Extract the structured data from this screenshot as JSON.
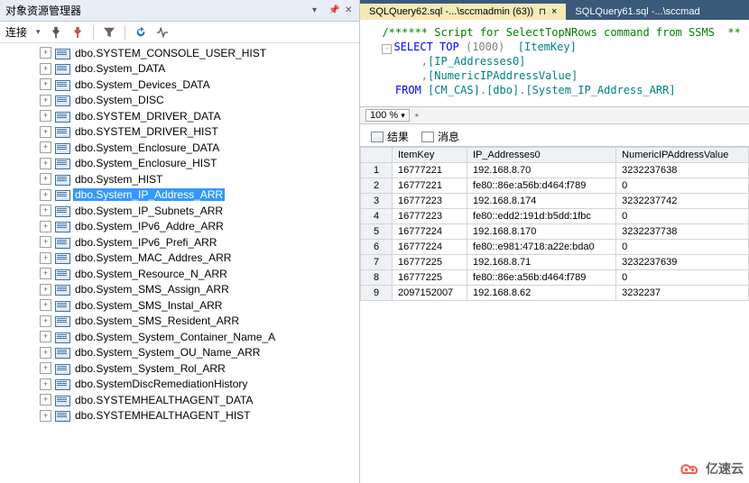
{
  "panel": {
    "title": "对象资源管理器"
  },
  "toolbar": {
    "connect_label": "连接"
  },
  "tree": {
    "items": [
      "dbo.SYSTEM_CONSOLE_USER_HIST",
      "dbo.System_DATA",
      "dbo.System_Devices_DATA",
      "dbo.System_DISC",
      "dbo.SYSTEM_DRIVER_DATA",
      "dbo.SYSTEM_DRIVER_HIST",
      "dbo.System_Enclosure_DATA",
      "dbo.System_Enclosure_HIST",
      "dbo.System_HIST",
      "dbo.System_IP_Address_ARR",
      "dbo.System_IP_Subnets_ARR",
      "dbo.System_IPv6_Addre_ARR",
      "dbo.System_IPv6_Prefi_ARR",
      "dbo.System_MAC_Addres_ARR",
      "dbo.System_Resource_N_ARR",
      "dbo.System_SMS_Assign_ARR",
      "dbo.System_SMS_Instal_ARR",
      "dbo.System_SMS_Resident_ARR",
      "dbo.System_System_Container_Name_A",
      "dbo.System_System_OU_Name_ARR",
      "dbo.System_System_Rol_ARR",
      "dbo.SystemDiscRemediationHistory",
      "dbo.SYSTEMHEALTHAGENT_DATA",
      "dbo.SYSTEMHEALTHAGENT_HIST"
    ],
    "selected_index": 9
  },
  "tabs": {
    "active": "SQLQuery62.sql -...\\sccmadmin (63))",
    "inactive": "SQLQuery61.sql -...\\sccmad"
  },
  "sql": {
    "comment": "/****** Script for SelectTopNRows command from SSMS  **",
    "select": "SELECT",
    "top": "TOP",
    "topn": "(1000)",
    "col1": "[ItemKey]",
    "col2": "[IP_Addresses0]",
    "col3": "[NumericIPAddressValue]",
    "from": "FROM",
    "db": "[CM_CAS]",
    "schema": "[dbo]",
    "table": "[System_IP_Address_ARR]"
  },
  "zoom": "100 %",
  "result_tabs": {
    "results": "结果",
    "messages": "消息"
  },
  "grid": {
    "headers": [
      "ItemKey",
      "IP_Addresses0",
      "NumericIPAddressValue"
    ],
    "rows": [
      [
        "16777221",
        "192.168.8.70",
        "3232237638"
      ],
      [
        "16777221",
        "fe80::86e:a56b:d464:f789",
        "0"
      ],
      [
        "16777223",
        "192.168.8.174",
        "3232237742"
      ],
      [
        "16777223",
        "fe80::edd2:191d:b5dd:1fbc",
        "0"
      ],
      [
        "16777224",
        "192.168.8.170",
        "3232237738"
      ],
      [
        "16777224",
        "fe80::e981:4718:a22e:bda0",
        "0"
      ],
      [
        "16777225",
        "192.168.8.71",
        "3232237639"
      ],
      [
        "16777225",
        "fe80::86e:a56b:d464:f789",
        "0"
      ],
      [
        "2097152007",
        "192.168.8.62",
        "3232237"
      ]
    ]
  },
  "watermark": "亿速云"
}
